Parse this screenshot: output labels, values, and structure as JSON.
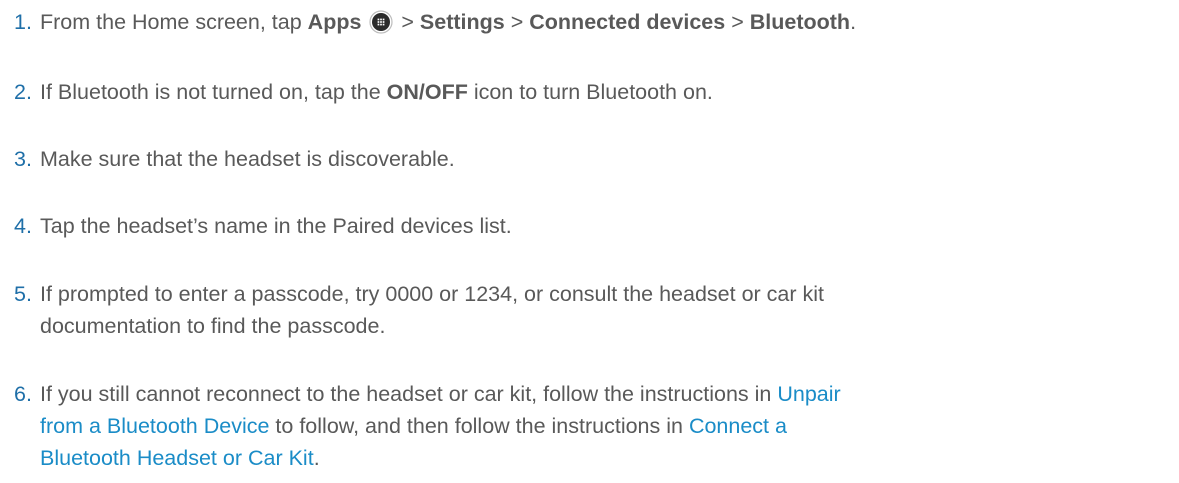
{
  "colors": {
    "text": "#595959",
    "number": "#1f6fa8",
    "link": "#1a8cc7",
    "icon_bg": "#2b2b2b"
  },
  "steps": [
    {
      "number": "1.",
      "t1": "From the Home screen, tap ",
      "apps": "Apps",
      "icon": "apps-grid-icon",
      "sep1": " > ",
      "settings": "Settings",
      "sep2": " > ",
      "connected": "Connected devices",
      "sep3": " > ",
      "bluetooth": "Bluetooth",
      "end": "."
    },
    {
      "number": "2.",
      "t1": "If Bluetooth is not turned on, tap the ",
      "onoff": "ON/OFF",
      "t2": " icon to turn Bluetooth on."
    },
    {
      "number": "3.",
      "t1": "Make sure that the headset is discoverable."
    },
    {
      "number": "4.",
      "t1": "Tap the headset’s name in the Paired devices list."
    },
    {
      "number": "5.",
      "line1": "If prompted to enter a passcode, try 0000 or 1234, or consult the headset or car kit",
      "line2": "documentation to find the passcode."
    },
    {
      "number": "6.",
      "t1": "If you still cannot reconnect to the headset or car kit, follow the instructions in ",
      "link1_a": "Unpair",
      "link1_b": "from a Bluetooth Device",
      "t2": " to follow, and then follow the instructions in ",
      "link2_a": "Connect a",
      "link2_b": "Bluetooth Headset or Car Kit",
      "end": "."
    }
  ]
}
